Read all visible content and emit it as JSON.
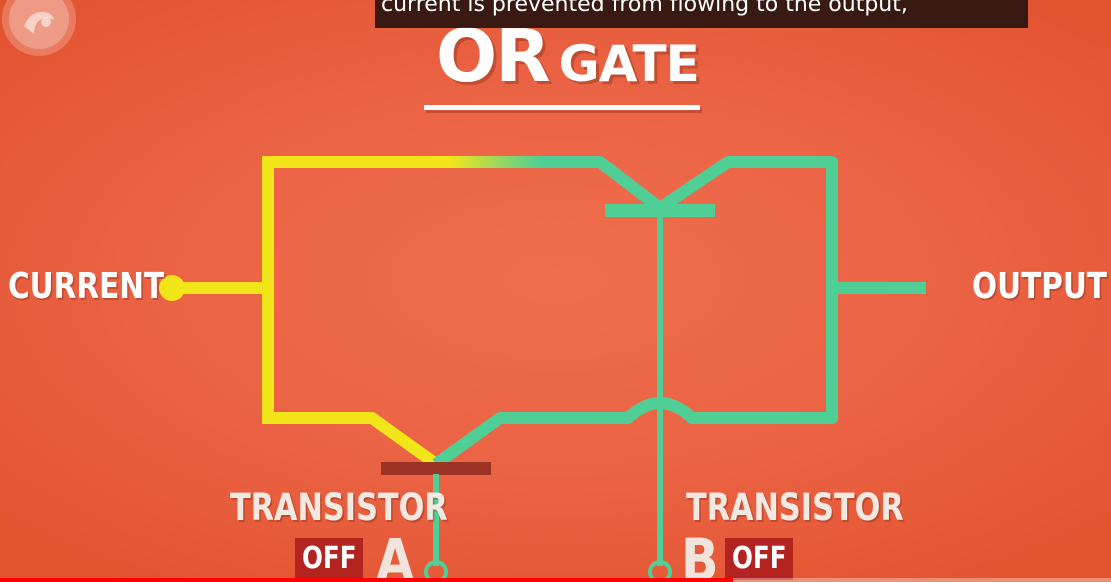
{
  "caption": {
    "text": "current is prevented from flowing to the output,"
  },
  "title": {
    "big": "OR",
    "small": "GATE"
  },
  "labels": {
    "current": "CURRENT",
    "output": "OUTPUT",
    "transistor_a": "TRANSISTOR",
    "transistor_b": "TRANSISTOR",
    "letter_a": "A",
    "letter_b": "B",
    "state_a": "OFF",
    "state_b": "OFF"
  },
  "icons": {
    "logo": "pbs-logo-icon"
  },
  "colors": {
    "background": "#ea6243",
    "powered_wire": "#f2e51a",
    "unpowered_wire": "#4fcf96",
    "transistor_off_bar": "#9c3426",
    "off_badge": "#b3231f",
    "caption_bg": "#080808",
    "progress": "#ff0000"
  },
  "video_progress": {
    "played_fraction": 0.66
  }
}
